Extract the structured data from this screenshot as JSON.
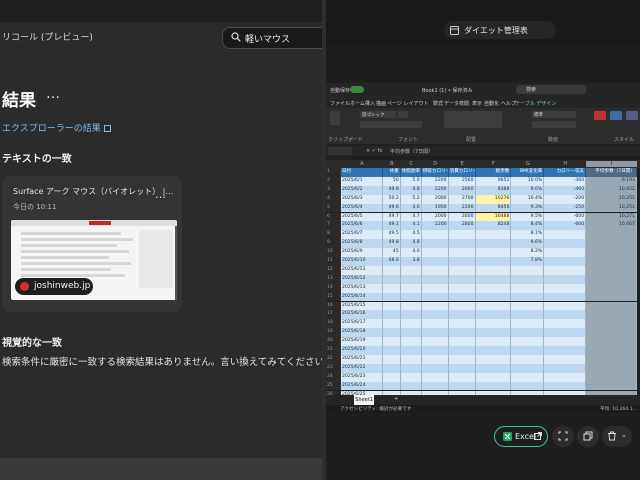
{
  "left": {
    "app_title": "リコール (プレビュー)",
    "search_query": "軽いマウス",
    "results_title": "結果",
    "more_label": "…",
    "explorer_link": "エクスプローラーの結果",
    "text_match_heading": "テキストの一致",
    "card": {
      "title": "Surface アーク マウス（バイオレット） |…",
      "date": "今日の 10:11",
      "more": "…",
      "site": "joshinweb.jp"
    },
    "visual_match_heading": "視覚的な一致",
    "no_results": "検索条件に厳密に一致する検索結果はありません。言い換えてみてください。"
  },
  "right": {
    "viewer_title": "ダイエット管理表",
    "excel": {
      "autosave": "自動保存",
      "book": "Book1 (1) • 保存済み",
      "search": "検索",
      "menu": [
        "ファイル",
        "ホーム",
        "挿入",
        "描画",
        "ページ レイアウト",
        "数式",
        "データ",
        "校閲",
        "表示",
        "自動化",
        "ヘルプ",
        "テーブル デザイン"
      ],
      "ribbon_groups": [
        "クリップボード",
        "フォント",
        "配置",
        "数値",
        "スタイル"
      ],
      "font_name": "游ゴシック",
      "number_format": "標準",
      "cond_format": "条件付き書式",
      "table_format": "テーブルとして書式設定",
      "cell_style": "セルのスタイル",
      "formula_value": "平均歩数（7日間）",
      "columns": [
        "A",
        "B",
        "C",
        "D",
        "E",
        "F",
        "G",
        "H",
        "I"
      ],
      "headers": [
        "日付",
        "体重",
        "体脂肪率",
        "摂取カロリー",
        "消費カロリー",
        "総歩数",
        "BMI変化率",
        "カロリー収支",
        "平均歩数（7日間）"
      ],
      "rows": [
        [
          "2025/6/1",
          "50",
          "5.0",
          "2200",
          "2560",
          "9651",
          "10.0%",
          "-360",
          "9,193"
        ],
        [
          "2025/6/2",
          "49.8",
          "4.8",
          "2200",
          "2660",
          "8388",
          "9.6%",
          "-460",
          "10,652"
        ],
        [
          "2025/6/3",
          "50.2",
          "5.2",
          "2000",
          "2700",
          "10276",
          "10.4%",
          "-200",
          "10,251"
        ],
        [
          "2025/6/4",
          "49.6",
          "4.6",
          "1950",
          "2200",
          "8456",
          "9.3%",
          "-250",
          "10,251"
        ],
        [
          "2025/6/5",
          "49.7",
          "4.7",
          "2000",
          "2600",
          "16488",
          "9.5%",
          "-600",
          "10,271"
        ],
        [
          "2025/6/6",
          "49.1",
          "4.1",
          "2200",
          "2800",
          "8248",
          "8.4%",
          "-600",
          "10,667"
        ],
        [
          "2025/6/7",
          "49.5",
          "4.5",
          "",
          "",
          "",
          "8.1%",
          "",
          ""
        ],
        [
          "2025/6/8",
          "49.8",
          "4.8",
          "",
          "",
          "",
          "9.6%",
          "",
          ""
        ],
        [
          "2025/6/9",
          "45",
          "4.0",
          "",
          "",
          "",
          "8.2%",
          "",
          ""
        ],
        [
          "2025/6/10",
          "48.8",
          "3.8",
          "",
          "",
          "",
          "7.8%",
          "",
          ""
        ],
        [
          "2025/6/11",
          "",
          "",
          "",
          "",
          "",
          "",
          "",
          ""
        ],
        [
          "2025/6/12",
          "",
          "",
          "",
          "",
          "",
          "",
          "",
          ""
        ],
        [
          "2025/6/13",
          "",
          "",
          "",
          "",
          "",
          "",
          "",
          ""
        ],
        [
          "2025/6/14",
          "",
          "",
          "",
          "",
          "",
          "",
          "",
          ""
        ],
        [
          "2025/6/15",
          "",
          "",
          "",
          "",
          "",
          "",
          "",
          ""
        ],
        [
          "2025/6/16",
          "",
          "",
          "",
          "",
          "",
          "",
          "",
          ""
        ],
        [
          "2025/6/17",
          "",
          "",
          "",
          "",
          "",
          "",
          "",
          ""
        ],
        [
          "2025/6/18",
          "",
          "",
          "",
          "",
          "",
          "",
          "",
          ""
        ],
        [
          "2025/6/19",
          "",
          "",
          "",
          "",
          "",
          "",
          "",
          ""
        ],
        [
          "2025/6/20",
          "",
          "",
          "",
          "",
          "",
          "",
          "",
          ""
        ],
        [
          "2025/6/21",
          "",
          "",
          "",
          "",
          "",
          "",
          "",
          ""
        ],
        [
          "2025/6/22",
          "",
          "",
          "",
          "",
          "",
          "",
          "",
          ""
        ],
        [
          "2025/6/23",
          "",
          "",
          "",
          "",
          "",
          "",
          "",
          ""
        ],
        [
          "2025/6/24",
          "",
          "",
          "",
          "",
          "",
          "",
          "",
          ""
        ],
        [
          "2025/6/25",
          "",
          "",
          "",
          "",
          "",
          "",
          "",
          ""
        ]
      ],
      "highlighted_steps": [
        "10276",
        "16488"
      ],
      "sheet_tab": "Sheet1",
      "status_left": "アクセシビリティ: 検討が必要です",
      "status_right": "平均: 10,264.1…"
    },
    "open_excel_label": "Excel"
  },
  "colors": {
    "accent_teal": "#40c4b0",
    "link_blue": "#7dbbf0",
    "table_header": "#2f75b5",
    "band_light": "#ddebf7",
    "band_dark": "#bdd7ee",
    "highlight_yellow": "#fff2a8",
    "selected_column": "#9aa8b4"
  }
}
